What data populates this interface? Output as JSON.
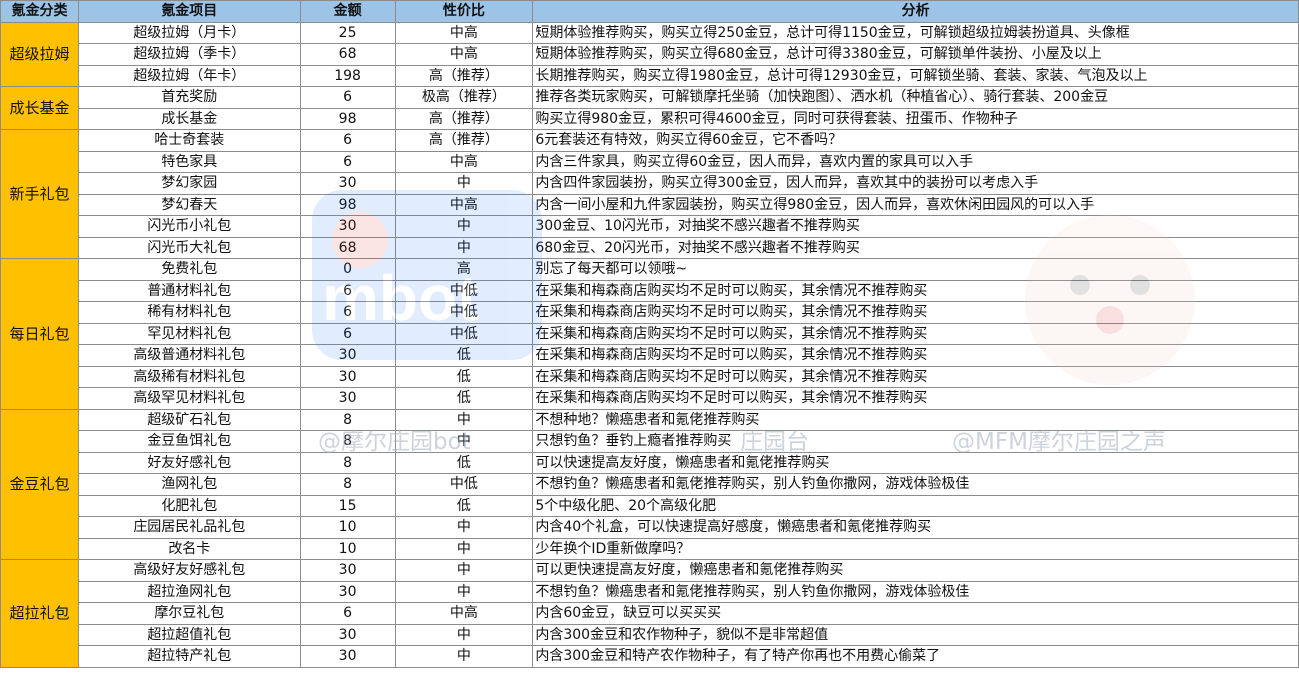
{
  "headers": {
    "category": "氪金分类",
    "item": "氪金项目",
    "price": "金额",
    "value": "性价比",
    "analysis": "分析"
  },
  "groups": [
    {
      "name": "超级拉姆",
      "rows": [
        {
          "item": "超级拉姆（月卡）",
          "price": "25",
          "value": "中高",
          "analysis": "短期体验推荐购买，购买立得250金豆，总计可得1150金豆，可解锁超级拉姆装扮道具、头像框"
        },
        {
          "item": "超级拉姆（季卡）",
          "price": "68",
          "value": "中高",
          "analysis": "短期体验推荐购买，购买立得680金豆，总计可得3380金豆，可解锁单件装扮、小屋及以上"
        },
        {
          "item": "超级拉姆（年卡）",
          "price": "198",
          "value": "高（推荐）",
          "analysis": "长期推荐购买，购买立得1980金豆，总计可得12930金豆，可解锁坐骑、套装、家装、气泡及以上"
        }
      ]
    },
    {
      "name": "成长基金",
      "rows": [
        {
          "item": "首充奖励",
          "price": "6",
          "value": "极高（推荐）",
          "analysis": "推荐各类玩家购买，可解锁摩托坐骑（加快跑图）、洒水机（种植省心）、骑行套装、200金豆"
        },
        {
          "item": "成长基金",
          "price": "98",
          "value": "高（推荐）",
          "analysis": "购买立得980金豆，累积可得4600金豆，同时可获得套装、扭蛋币、作物种子"
        }
      ]
    },
    {
      "name": "新手礼包",
      "rows": [
        {
          "item": "哈士奇套装",
          "price": "6",
          "value": "高（推荐）",
          "analysis": "6元套装还有特效，购买立得60金豆，它不香吗？"
        },
        {
          "item": "特色家具",
          "price": "6",
          "value": "中高",
          "analysis": "内含三件家具，购买立得60金豆，因人而异，喜欢内置的家具可以入手"
        },
        {
          "item": "梦幻家园",
          "price": "30",
          "value": "中",
          "analysis": "内含四件家园装扮，购买立得300金豆，因人而异，喜欢其中的装扮可以考虑入手"
        },
        {
          "item": "梦幻春天",
          "price": "98",
          "value": "中高",
          "analysis": "内含一间小屋和九件家园装扮，购买立得980金豆，因人而异，喜欢休闲田园风的可以入手"
        },
        {
          "item": "闪光币小礼包",
          "price": "30",
          "value": "中",
          "analysis": "300金豆、10闪光币，对抽奖不感兴趣者不推荐购买"
        },
        {
          "item": "闪光币大礼包",
          "price": "68",
          "value": "中",
          "analysis": "680金豆、20闪光币，对抽奖不感兴趣者不推荐购买"
        }
      ]
    },
    {
      "name": "每日礼包",
      "rows": [
        {
          "item": "免费礼包",
          "price": "0",
          "value": "高",
          "analysis": "别忘了每天都可以领哦~"
        },
        {
          "item": "普通材料礼包",
          "price": "6",
          "value": "中低",
          "analysis": "在采集和梅森商店购买均不足时可以购买，其余情况不推荐购买"
        },
        {
          "item": "稀有材料礼包",
          "price": "6",
          "value": "中低",
          "analysis": "在采集和梅森商店购买均不足时可以购买，其余情况不推荐购买"
        },
        {
          "item": "罕见材料礼包",
          "price": "6",
          "value": "中低",
          "analysis": "在采集和梅森商店购买均不足时可以购买，其余情况不推荐购买"
        },
        {
          "item": "高级普通材料礼包",
          "price": "30",
          "value": "低",
          "analysis": "在采集和梅森商店购买均不足时可以购买，其余情况不推荐购买"
        },
        {
          "item": "高级稀有材料礼包",
          "price": "30",
          "value": "低",
          "analysis": "在采集和梅森商店购买均不足时可以购买，其余情况不推荐购买"
        },
        {
          "item": "高级罕见材料礼包",
          "price": "30",
          "value": "低",
          "analysis": "在采集和梅森商店购买均不足时可以购买，其余情况不推荐购买"
        }
      ]
    },
    {
      "name": "金豆礼包",
      "rows": [
        {
          "item": "超级矿石礼包",
          "price": "8",
          "value": "中",
          "analysis": "不想种地？懒癌患者和氪佬推荐购买"
        },
        {
          "item": "金豆鱼饵礼包",
          "price": "8",
          "value": "中",
          "analysis": "只想钓鱼？垂钓上瘾者推荐购买"
        },
        {
          "item": "好友好感礼包",
          "price": "8",
          "value": "低",
          "analysis": "可以快速提高友好度，懒癌患者和氪佬推荐购买"
        },
        {
          "item": "渔网礼包",
          "price": "8",
          "value": "中低",
          "analysis": "不想钓鱼？懒癌患者和氪佬推荐购买，别人钓鱼你撒网，游戏体验极佳"
        },
        {
          "item": "化肥礼包",
          "price": "15",
          "value": "低",
          "analysis": "5个中级化肥、20个高级化肥"
        },
        {
          "item": "庄园居民礼品礼包",
          "price": "10",
          "value": "中",
          "analysis": "内含40个礼盒，可以快速提高好感度，懒癌患者和氪佬推荐购买"
        },
        {
          "item": "改名卡",
          "price": "10",
          "value": "中",
          "analysis": "少年换个ID重新做摩吗？"
        }
      ]
    },
    {
      "name": "超拉礼包",
      "rows": [
        {
          "item": "高级好友好感礼包",
          "price": "30",
          "value": "中",
          "analysis": "可以更快速提高友好度，懒癌患者和氪佬推荐购买"
        },
        {
          "item": "超拉渔网礼包",
          "price": "30",
          "value": "中",
          "analysis": "不想钓鱼？懒癌患者和氪佬推荐购买，别人钓鱼你撒网，游戏体验极佳"
        },
        {
          "item": "摩尔豆礼包",
          "price": "6",
          "value": "中高",
          "analysis": "内含60金豆，缺豆可以买买买"
        },
        {
          "item": "超拉超值礼包",
          "price": "30",
          "value": "中",
          "analysis": "内含300金豆和农作物种子，貌似不是非常超值"
        },
        {
          "item": "超拉特产礼包",
          "price": "30",
          "value": "中",
          "analysis": "内含300金豆和特产农作物种子，有了特产你再也不用费心偷菜了"
        }
      ]
    }
  ],
  "watermarks": {
    "left_logo": "mbot",
    "left_text": "@摩尔庄园bot",
    "mid_text": "庄园台",
    "right_text": "@MFM摩尔庄园之声"
  }
}
